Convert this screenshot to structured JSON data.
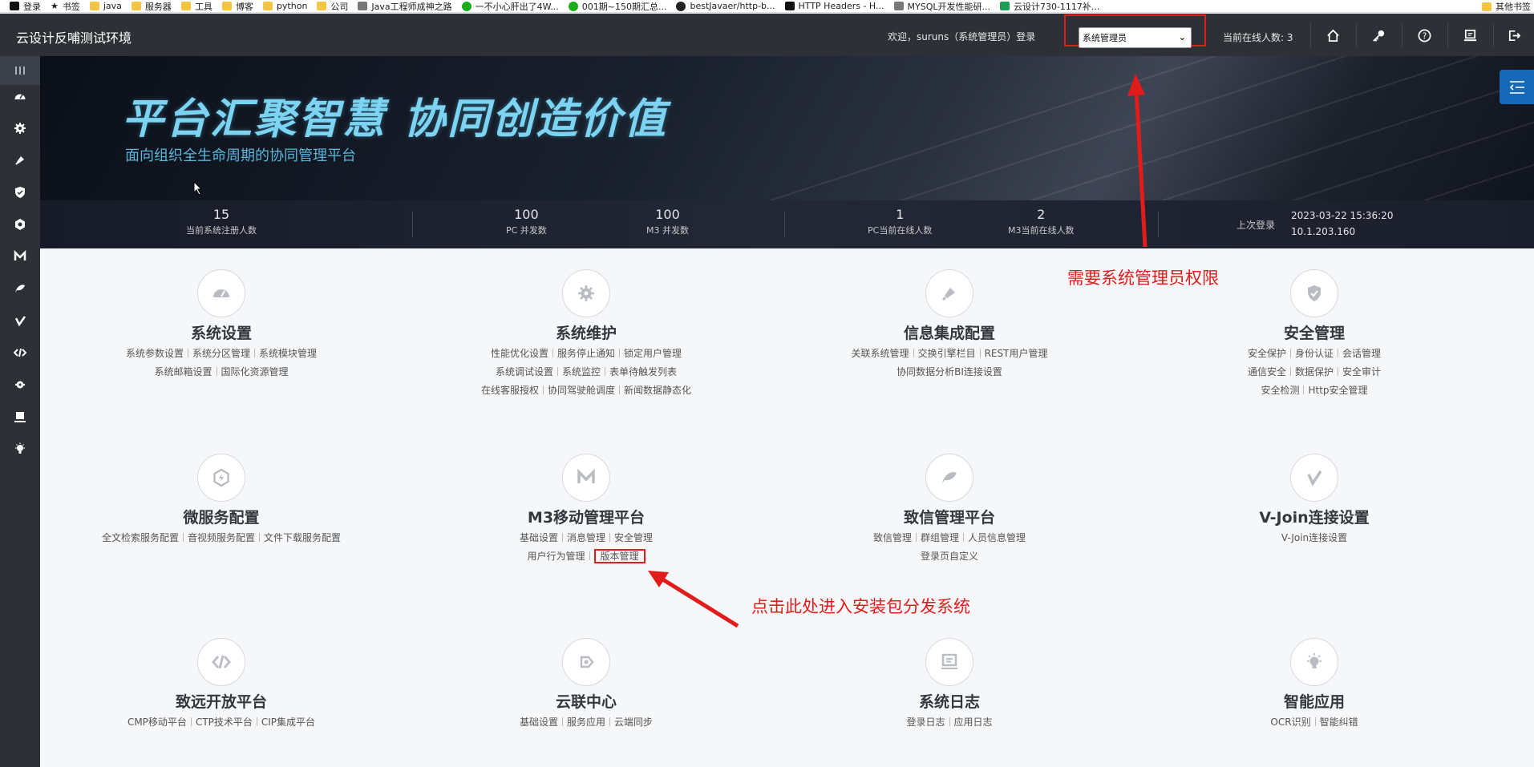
{
  "bookmarks": {
    "items": [
      {
        "label": "登录",
        "icon": "login-icon"
      },
      {
        "label": "书签",
        "icon": "star-icon"
      },
      {
        "label": "java",
        "icon": "folder-icon"
      },
      {
        "label": "服务器",
        "icon": "folder-icon"
      },
      {
        "label": "工具",
        "icon": "folder-icon"
      },
      {
        "label": "博客",
        "icon": "folder-icon"
      },
      {
        "label": "python",
        "icon": "folder-icon"
      },
      {
        "label": "公司",
        "icon": "folder-icon"
      },
      {
        "label": "Java工程师成神之路",
        "icon": "globe-icon"
      },
      {
        "label": "一不小心肝出了4W...",
        "icon": "wechat-icon"
      },
      {
        "label": "001期~150期汇总...",
        "icon": "wechat-icon"
      },
      {
        "label": "bestJavaer/http-b...",
        "icon": "github-icon"
      },
      {
        "label": "HTTP Headers - H...",
        "icon": "mdn-icon"
      },
      {
        "label": "MYSQL开发性能研...",
        "icon": "page-icon"
      },
      {
        "label": "云设计730-1117补...",
        "icon": "sheet-icon"
      }
    ],
    "other": "其他书签"
  },
  "header": {
    "title": "云设计反哺测试环境",
    "welcome": "欢迎，suruns（系统管理员）登录",
    "role_select": "系统管理员",
    "online_count": "当前在线人数: 3",
    "icons": [
      "home-icon",
      "key-icon",
      "help-icon",
      "monitor-icon",
      "logout-icon"
    ]
  },
  "sidebar": {
    "icons": [
      "menu-icon",
      "dashboard-icon",
      "gear-icon",
      "plug-icon",
      "shield-icon",
      "hexagon-icon",
      "m3-icon",
      "leaf-icon",
      "vjoin-icon",
      "code-icon",
      "cloud-icon",
      "log-icon",
      "bulb-icon"
    ]
  },
  "banner": {
    "slogan": "平台汇聚智慧 协同创造价值",
    "subslogan": "面向组织全生命周期的协同管理平台"
  },
  "stats": {
    "registered": {
      "value": "15",
      "label": "当前系统注册人数"
    },
    "pc_concurrent": {
      "value": "100",
      "label": "PC 并发数"
    },
    "m3_concurrent": {
      "value": "100",
      "label": "M3 并发数"
    },
    "pc_online": {
      "value": "1",
      "label": "PC当前在线人数"
    },
    "m3_online": {
      "value": "2",
      "label": "M3当前在线人数"
    },
    "last_login_label": "上次登录",
    "last_login_time": "2023-03-22 15:36:20",
    "last_login_ip": "10.1.203.160"
  },
  "modules": [
    {
      "title": "系统设置",
      "icon": "dashboard-icon",
      "rows": [
        [
          "系统参数设置",
          "系统分区管理",
          "系统模块管理"
        ],
        [
          "系统邮箱设置",
          "国际化资源管理"
        ]
      ]
    },
    {
      "title": "系统维护",
      "icon": "gear-icon",
      "rows": [
        [
          "性能优化设置",
          "服务停止通知",
          "锁定用户管理"
        ],
        [
          "系统调试设置",
          "系统监控",
          "表单待触发列表"
        ],
        [
          "在线客服授权",
          "协同驾驶舱调度",
          "新闻数据静态化"
        ]
      ]
    },
    {
      "title": "信息集成配置",
      "icon": "plug-icon",
      "rows": [
        [
          "关联系统管理",
          "交换引擎栏目",
          "REST用户管理"
        ],
        [
          "协同数据分析BI连接设置"
        ]
      ]
    },
    {
      "title": "安全管理",
      "icon": "shield-icon",
      "rows": [
        [
          "安全保护",
          "身份认证",
          "会话管理"
        ],
        [
          "通信安全",
          "数据保护",
          "安全审计"
        ],
        [
          "安全检测",
          "Http安全管理"
        ]
      ]
    },
    {
      "title": "微服务配置",
      "icon": "hexagon-icon",
      "rows": [
        [
          "全文检索服务配置",
          "音视频服务配置",
          "文件下载服务配置"
        ]
      ]
    },
    {
      "title": "M3移动管理平台",
      "icon": "m3-icon",
      "rows": [
        [
          "基础设置",
          "消息管理",
          "安全管理"
        ],
        [
          "用户行为管理",
          "版本管理"
        ]
      ]
    },
    {
      "title": "致信管理平台",
      "icon": "leaf-icon",
      "rows": [
        [
          "致信管理",
          "群组管理",
          "人员信息管理"
        ],
        [
          "登录页自定义"
        ]
      ]
    },
    {
      "title": "V-Join连接设置",
      "icon": "vjoin-icon",
      "rows": [
        [
          "V-Join连接设置"
        ]
      ]
    },
    {
      "title": "致远开放平台",
      "icon": "code-icon",
      "rows": [
        [
          "CMP移动平台",
          "CTP技术平台",
          "CIP集成平台"
        ]
      ]
    },
    {
      "title": "云联中心",
      "icon": "cloud-icon",
      "rows": [
        [
          "基础设置",
          "服务应用",
          "云端同步"
        ]
      ]
    },
    {
      "title": "系统日志",
      "icon": "log-icon",
      "rows": [
        [
          "登录日志",
          "应用日志"
        ]
      ]
    },
    {
      "title": "智能应用",
      "icon": "bulb-icon",
      "rows": [
        [
          "OCR识别",
          "智能纠错"
        ]
      ]
    }
  ],
  "annotations": {
    "role_note": "需要系统管理员权限",
    "version_note": "点击此处进入安装包分发系统"
  },
  "colors": {
    "topbar": "#2d3036",
    "annotation": "#e21b1b",
    "slogan": "#7dd4f2",
    "collapse_button": "#1769b8"
  }
}
